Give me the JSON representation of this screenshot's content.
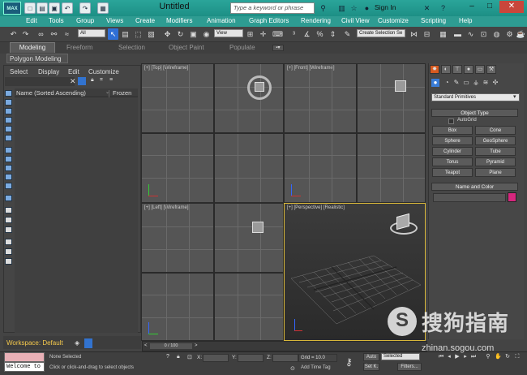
{
  "window": {
    "title": "Untitled",
    "search_placeholder": "Type a keyword or phrase",
    "sign_in": "Sign In",
    "logo": "MAX",
    "quick_access_icons": [
      "new-icon",
      "open-icon",
      "save-icon",
      "undo-icon",
      "redo-icon",
      "project-icon"
    ],
    "controls": [
      "minimize-icon",
      "maximize-icon",
      "close-icon"
    ]
  },
  "menu": [
    "Edit",
    "Tools",
    "Group",
    "Views",
    "Create",
    "Modifiers",
    "Animation",
    "Graph Editors",
    "Rendering",
    "Civil View",
    "Customize",
    "Scripting",
    "Help"
  ],
  "toolbar": {
    "selection_filter": "All",
    "reference_coord": "View",
    "named_selection": "Create Selection Se"
  },
  "ribbon": {
    "tabs": [
      "Modeling",
      "Freeform",
      "Selection",
      "Object Paint",
      "Populate"
    ],
    "active_panel": "Polygon Modeling"
  },
  "scene_explorer": {
    "menu": [
      "Select",
      "Display",
      "Edit",
      "Customize"
    ],
    "columns": [
      "Name (Sorted Ascending)",
      "Frozen"
    ]
  },
  "viewports": {
    "top": "[+] [Top] [Wireframe]",
    "front": "[+] [Front] [Wireframe]",
    "left": "[+] [Left] [Wireframe]",
    "perspective": "[+] [Perspective] [Realistic]"
  },
  "command_panel": {
    "dropdown": "Standard Primitives",
    "object_type_title": "Object Type",
    "autogrid": "AutoGrid",
    "buttons": [
      "Box",
      "Cone",
      "Sphere",
      "GeoSphere",
      "Cylinder",
      "Tube",
      "Torus",
      "Pyramid",
      "Teapot",
      "Plane"
    ],
    "name_color_title": "Name and Color",
    "swatch_color": "#d6277e"
  },
  "bottom": {
    "workspace": "Workspace: Default",
    "frame_counter": "0 / 100",
    "maxscript_text": "Welcome to",
    "status_selected": "None Selected",
    "status_hint": "Click or click-and-drag to select objects",
    "x_label": "X:",
    "y_label": "Y:",
    "z_label": "Z:",
    "grid": "Grid = 10.0",
    "add_time_tag": "Add Time Tag",
    "auto_label": "Auto",
    "selected_dd": "Selected",
    "setk_label": "Set K.",
    "filters_label": "Filters..."
  },
  "watermark": {
    "logo_glyph": "S",
    "text": "搜狗指南",
    "url": "zhinan.sogou.com"
  }
}
